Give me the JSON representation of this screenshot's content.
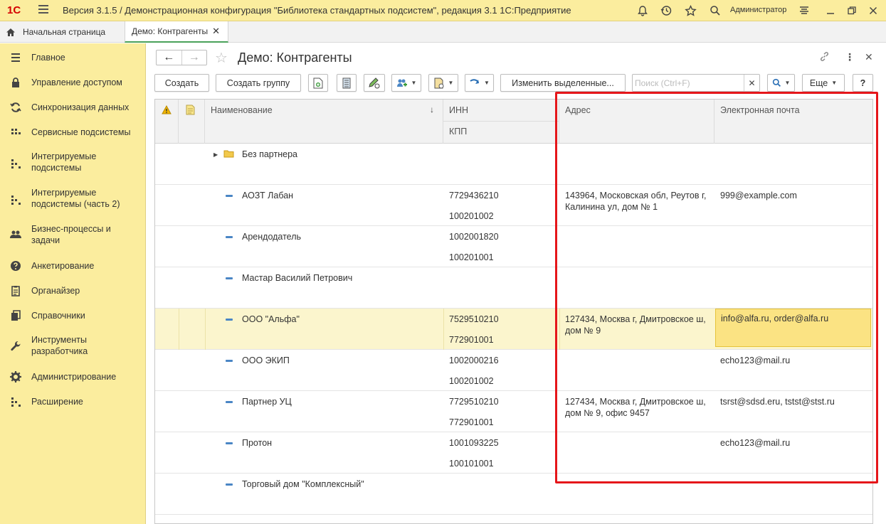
{
  "app": {
    "title": "Версия 3.1.5 / Демонстрационная конфигурация \"Библиотека стандартных подсистем\", редакция 3.1 1С:Предприятие",
    "logo": "1С",
    "user": "Администратор"
  },
  "tabs": {
    "home": "Начальная страница",
    "active": "Демо: Контрагенты"
  },
  "sidebar": {
    "items": [
      {
        "label": "Главное",
        "icon": "list-icon"
      },
      {
        "label": "Управление доступом",
        "icon": "lock-icon"
      },
      {
        "label": "Синхронизация данных",
        "icon": "sync-icon"
      },
      {
        "label": "Сервисные подсистемы",
        "icon": "grid-icon"
      },
      {
        "label": "Интегрируемые\nподсистемы",
        "icon": "grid-icon"
      },
      {
        "label": "Интегрируемые\nподсистемы (часть 2)",
        "icon": "grid-icon"
      },
      {
        "label": "Бизнес-процессы и\nзадачи",
        "icon": "users-icon"
      },
      {
        "label": "Анкетирование",
        "icon": "question-icon"
      },
      {
        "label": "Органайзер",
        "icon": "clipboard-icon"
      },
      {
        "label": "Справочники",
        "icon": "books-icon"
      },
      {
        "label": "Инструменты\nразработчика",
        "icon": "wrench-icon"
      },
      {
        "label": "Администрирование",
        "icon": "gear-icon"
      },
      {
        "label": "Расширение",
        "icon": "grid-icon"
      }
    ]
  },
  "form": {
    "title": "Демо: Контрагенты",
    "toolbar": {
      "create": "Создать",
      "create_group": "Создать группу",
      "edit_selected": "Изменить выделенные...",
      "search_placeholder": "Поиск (Ctrl+F)",
      "more": "Еще",
      "help": "?"
    }
  },
  "table": {
    "columns": {
      "name": "Наименование",
      "inn": "ИНН",
      "kpp": "КПП",
      "address": "Адрес",
      "email": "Электронная почта"
    },
    "rows": [
      {
        "type": "group",
        "name": "Без партнера",
        "inn": "",
        "kpp": "",
        "address": "",
        "email": ""
      },
      {
        "type": "item",
        "name": "АОЗТ Лабан",
        "inn": "7729436210",
        "kpp": "100201002",
        "address": "143964, Московская обл, Реутов г, Калинина ул, дом № 1",
        "email": "999@example.com"
      },
      {
        "type": "item",
        "name": "Арендодатель",
        "inn": "1002001820",
        "kpp": "100201001",
        "address": "",
        "email": ""
      },
      {
        "type": "item",
        "name": "Мастар Василий Петрович",
        "inn": "",
        "kpp": "",
        "address": "",
        "email": ""
      },
      {
        "type": "item",
        "name": "ООО \"Альфа\"",
        "inn": "7529510210",
        "kpp": "772901001",
        "address": "127434, Москва г, Дмитровское ш, дом № 9",
        "email": "info@alfa.ru, order@alfa.ru",
        "selected": true
      },
      {
        "type": "item",
        "name": "ООО ЭКИП",
        "inn": "1002000216",
        "kpp": "100201002",
        "address": "",
        "email": "echo123@mail.ru"
      },
      {
        "type": "item",
        "name": "Партнер УЦ",
        "inn": "7729510210",
        "kpp": "772901001",
        "address": "127434, Москва г, Дмитровское ш, дом № 9, офис 9457",
        "email": "tsrst@sdsd.eru, tstst@stst.ru"
      },
      {
        "type": "item",
        "name": "Протон",
        "inn": "1001093225",
        "kpp": "100101001",
        "address": "",
        "email": "echo123@mail.ru"
      },
      {
        "type": "item",
        "name": "Торговый дом \"Комплексный\"",
        "inn": "",
        "kpp": "",
        "address": "",
        "email": ""
      }
    ]
  },
  "colors": {
    "sidebar_bg": "#fbed9e",
    "selected_row": "#fbf5cd",
    "selected_cell": "#fbe383",
    "highlight_box": "#e5161a",
    "accent_green": "#4aa15a"
  }
}
